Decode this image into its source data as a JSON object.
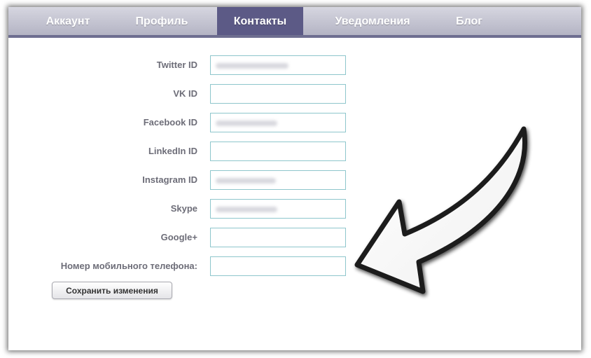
{
  "tabs": [
    {
      "label": "Аккаунт",
      "active": false
    },
    {
      "label": "Профиль",
      "active": false
    },
    {
      "label": "Контакты",
      "active": true
    },
    {
      "label": "Уведомления",
      "active": false
    },
    {
      "label": "Блог",
      "active": false
    }
  ],
  "form": {
    "fields": [
      {
        "label": "Twitter ID",
        "value": ""
      },
      {
        "label": "VK ID",
        "value": ""
      },
      {
        "label": "Facebook ID",
        "value": ""
      },
      {
        "label": "LinkedIn ID",
        "value": ""
      },
      {
        "label": "Instagram ID",
        "value": ""
      },
      {
        "label": "Skype",
        "value": ""
      },
      {
        "label": "Google+",
        "value": ""
      },
      {
        "label": "Номер мобильного телефона:",
        "value": ""
      }
    ],
    "save_label": "Сохранить изменения"
  },
  "colors": {
    "tab_bar": "#c4c4d2",
    "tab_active": "#5c5a86",
    "input_border": "#8ec6cc",
    "label_text": "#6d6d78"
  },
  "annotation": {
    "icon": "curved-arrow-icon"
  }
}
